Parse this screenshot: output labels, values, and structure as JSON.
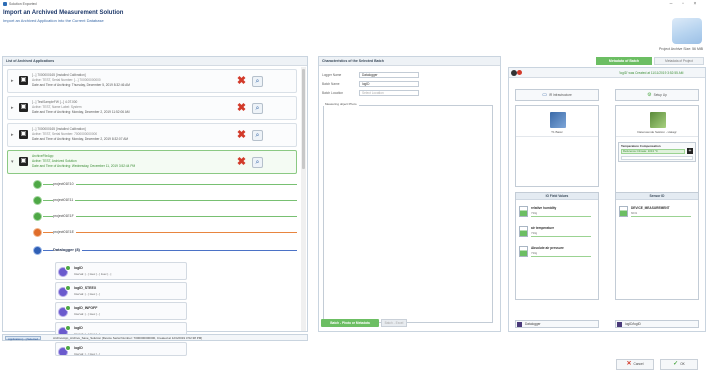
{
  "window": {
    "title": "Solution Exported",
    "minimize": "–",
    "maximize": "▫",
    "close": "×"
  },
  "header": {
    "title": "Import an Archived Measurement Solution",
    "subtitle": "Import an Archived Application into the Current Database",
    "project_size": "Project Archive Size: 56 MiB"
  },
  "left_panel": {
    "title": "List of Archived Applications",
    "applications": [
      {
        "line1": "[...] 7000000165 [Installed Calibration]",
        "line2": "Active: TEST, Serial Number: [...] 700000000000",
        "line3": "Date and Time of Archiving: Thursday, December 5, 2019 8:32:46 AM",
        "highlight": false
      },
      {
        "line1": "[...] TestSampleFW [...] 4.0T.000",
        "line2": "Active: TEST, Name Label: System",
        "line3": "Date and Time of Archiving: Monday, December 2, 2019 11:52:06 AM",
        "highlight": false
      },
      {
        "line1": "[...] 7000000165 [Installed Calibration]",
        "line2": "Active: TEST, Serial Number: 7000000000000",
        "line3": "Date and Time of Archiving: Monday, December 2, 2019 8:32:07 AM",
        "highlight": false
      },
      {
        "line1": "ArchiveFileApp",
        "line2": "Active: TEST, Archived Solution",
        "line3": "Date and Time of Archiving: Wednesday, December 11, 2019 3:52:44 PM",
        "highlight": true
      }
    ],
    "projects": [
      {
        "label": "project01E10",
        "color": "green"
      },
      {
        "label": "project01E11",
        "color": "green"
      },
      {
        "label": "project01E1F",
        "color": "green"
      },
      {
        "label": "project01E1E",
        "color": "orange"
      },
      {
        "label": "Datalogger (8)",
        "color": "blue",
        "bold": true
      }
    ],
    "loggers": [
      {
        "name": "logID",
        "detail": "Interval: [...] 1sec [...] 1sec [...]"
      },
      {
        "name": "logID_STEEX",
        "detail": "Interval: [...] 1sec [...]"
      },
      {
        "name": "logID_INFOFF",
        "detail": "Interval: [...] 1sec [...]"
      },
      {
        "name": "logID",
        "detail": "Interval: [...] 1sec [...]"
      },
      {
        "name": "logID",
        "detail": "Interval: [...] 1sec [...]"
      }
    ],
    "status_tab": "Application [...] Selected",
    "status_text": "ArchiveApp_Archive_Save_Solution [Device Serial Number: 7000000000000, Created at 12/4/2019 3:52:38 PM]"
  },
  "mid_panel": {
    "title": "Characteristics of the Selected Batch",
    "batch_name": "",
    "fields": [
      {
        "label": "Logger Name",
        "value": "Datalogger"
      },
      {
        "label": "Batch Name",
        "value": "logID"
      },
      {
        "label": "Batch Location",
        "value": "Select Location"
      }
    ],
    "measuring_objects_label": "Measuring object   Photo",
    "btn_batch": "Batch - Photo or Metadata",
    "btn_other": "Batch - Excel"
  },
  "right_panel": {
    "tab_metadata": "Metadata of Batch",
    "tab_project": "Metadata of Project",
    "top_text": "'logID' was Created at 11/11/2019 3:52:55 AM",
    "btn_left": "IR Infrastructure",
    "btn_right": "Setup Up",
    "device_left": "T1 Basic",
    "device_right": "Datenwende Sektion - Hatagr",
    "temp_comp_title": "Temperature Compensation",
    "temp_comp_value": "Reference Climate: 1013 °C",
    "ref_pressure": "Reference pressure",
    "list_left_title": "IO Field Values",
    "list_right_title": "Sensor ID",
    "channels_left": [
      {
        "name": "relative humidity",
        "sub": "730g"
      },
      {
        "name": "air temperature",
        "sub": "730g"
      },
      {
        "name": "Absolute air pressure",
        "sub": "730g"
      }
    ],
    "channels_right": [
      {
        "name": "DEVICE_MEASUREMENT",
        "sub": "6031"
      }
    ],
    "footer_left": "Datalogger",
    "footer_right": "logID/logID"
  },
  "buttons": {
    "cancel": "Cancel",
    "ok": "OK"
  },
  "colors": {
    "accent_green": "#6cbe63",
    "delete_red": "#d23a2a",
    "title_blue": "#1f3a6b"
  }
}
